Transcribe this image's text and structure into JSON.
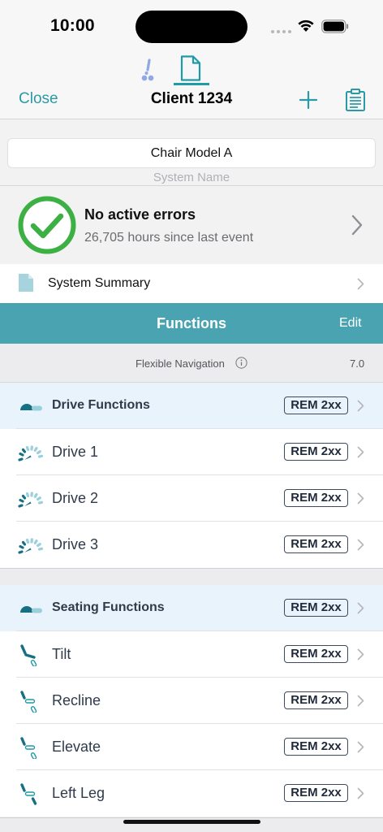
{
  "status_bar": {
    "time": "10:00"
  },
  "nav": {
    "close_label": "Close",
    "title": "Client 1234",
    "segments": [
      {
        "icon": "wheelchair-icon",
        "selected": false
      },
      {
        "icon": "document-icon",
        "selected": true
      }
    ],
    "actions": [
      "plus-icon",
      "clipboard-icon"
    ]
  },
  "system": {
    "name_value": "Chair Model A",
    "name_placeholder": "System Name"
  },
  "errors": {
    "title": "No active errors",
    "subtitle": "26,705 hours since last event"
  },
  "summary": {
    "label": "System Summary"
  },
  "functions": {
    "title": "Functions",
    "edit_label": "Edit",
    "flex_nav_label": "Flexible Navigation",
    "flex_nav_version": "7.0"
  },
  "drive_section": {
    "header": {
      "label": "Drive Functions",
      "badge": "REM 2xx"
    },
    "items": [
      {
        "label": "Drive 1",
        "badge": "REM 2xx"
      },
      {
        "label": "Drive 2",
        "badge": "REM 2xx"
      },
      {
        "label": "Drive 3",
        "badge": "REM 2xx"
      }
    ]
  },
  "seating_section": {
    "header": {
      "label": "Seating Functions",
      "badge": "REM 2xx"
    },
    "items": [
      {
        "label": "Tilt",
        "badge": "REM 2xx"
      },
      {
        "label": "Recline",
        "badge": "REM 2xx"
      },
      {
        "label": "Elevate",
        "badge": "REM 2xx"
      },
      {
        "label": "Left Leg",
        "badge": "REM 2xx"
      }
    ]
  },
  "colors": {
    "accent": "#2b9aa6",
    "functions_header": "#4aa3b0",
    "success": "#3cb043",
    "group_row": "#e9f3fb"
  }
}
